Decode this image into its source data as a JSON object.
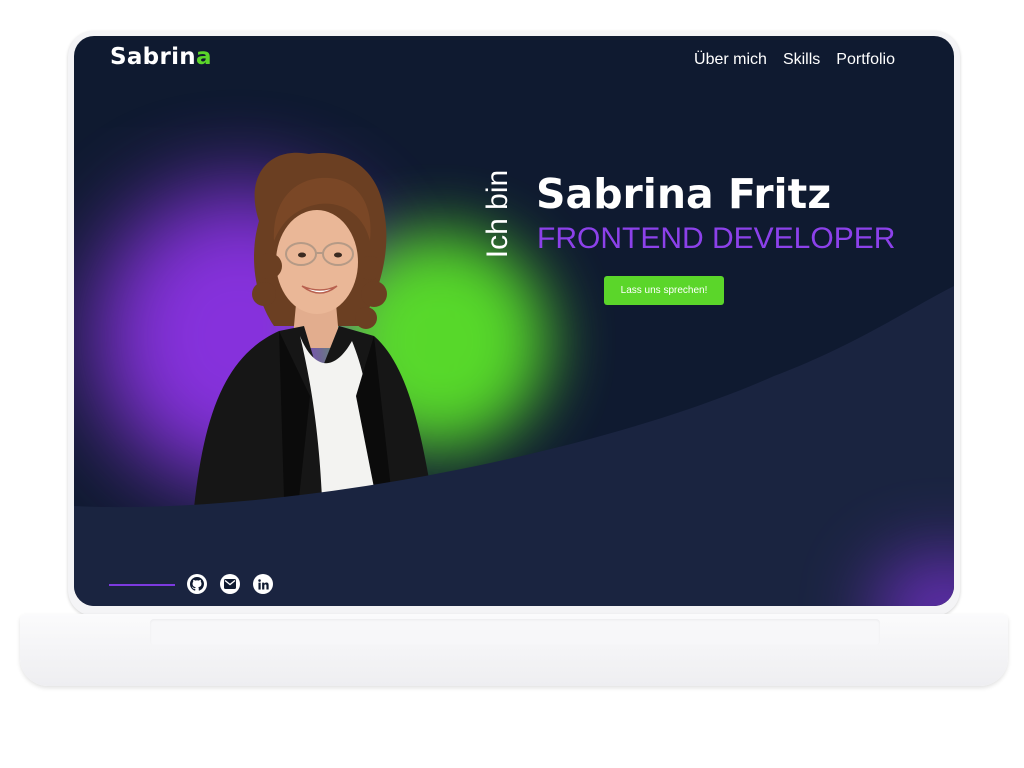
{
  "header": {
    "logo_main": "Sabrin",
    "logo_accent": "a",
    "nav": [
      {
        "label": "Über mich"
      },
      {
        "label": "Skills"
      },
      {
        "label": "Portfolio"
      }
    ]
  },
  "hero": {
    "intro": "Ich bin",
    "name": "Sabrina Fritz",
    "role": "FRONTEND DEVELOPER",
    "cta_label": "Lass uns sprechen!"
  },
  "social": {
    "icons": [
      "github-icon",
      "mail-icon",
      "linkedin-icon"
    ]
  },
  "colors": {
    "background": "#0f1a30",
    "accent_purple": "#8c41ea",
    "accent_green": "#5bd62a",
    "text": "#ffffff"
  }
}
